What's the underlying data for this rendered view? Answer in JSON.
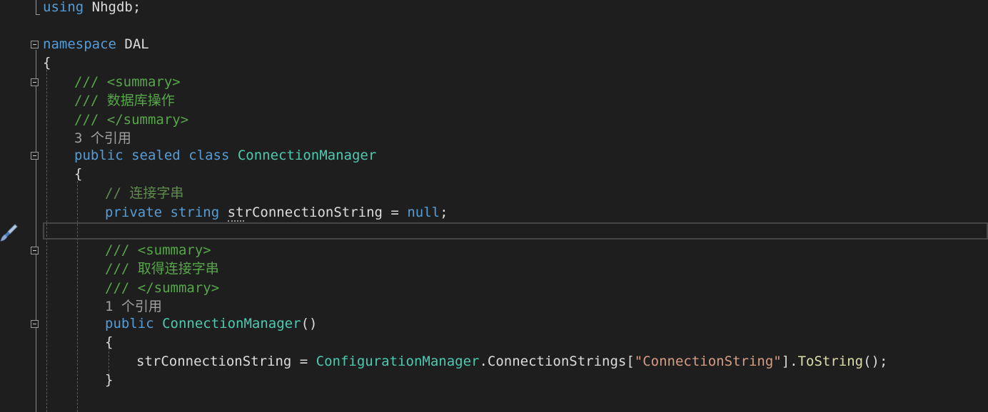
{
  "code": {
    "using_kw": "using",
    "using_ns": " Nhgdb;",
    "namespace_kw": "namespace",
    "namespace_name": " DAL",
    "brace_open": "{",
    "brace_close": "}",
    "summary_open": "/// <summary>",
    "summary_db": "/// 数据库操作",
    "summary_close": "/// </summary>",
    "refs_class": "3 个引用",
    "class_public": "public",
    "class_sealed": "sealed",
    "class_kw": "class",
    "class_name": "ConnectionManager",
    "comment_conn": "// 连接字串",
    "field_private": "private",
    "field_string": "string",
    "field_name_a": "st",
    "field_name_b": "rConnectionString",
    "field_assign": " = ",
    "field_null": "null",
    "semicolon": ";",
    "summary_get": "/// 取得连接字串",
    "refs_ctor": "1 个引用",
    "ctor_public": "public",
    "ctor_name": "ConnectionManager",
    "ctor_parens": "()",
    "assign_target": "strConnectionString",
    "assign_eq": " = ",
    "cfg_type": "ConfigurationManager",
    "cfg_member": ".ConnectionStrings[",
    "cfg_key": "\"ConnectionString\"",
    "cfg_close": "].",
    "tostring": "ToString",
    "call_end": "();"
  },
  "colors": {
    "background": "#1e1e1e",
    "keyword": "#569cd6",
    "type": "#4ec9b0",
    "comment": "#57a64a",
    "string": "#d69d85",
    "codelens": "#a0a0a0"
  }
}
